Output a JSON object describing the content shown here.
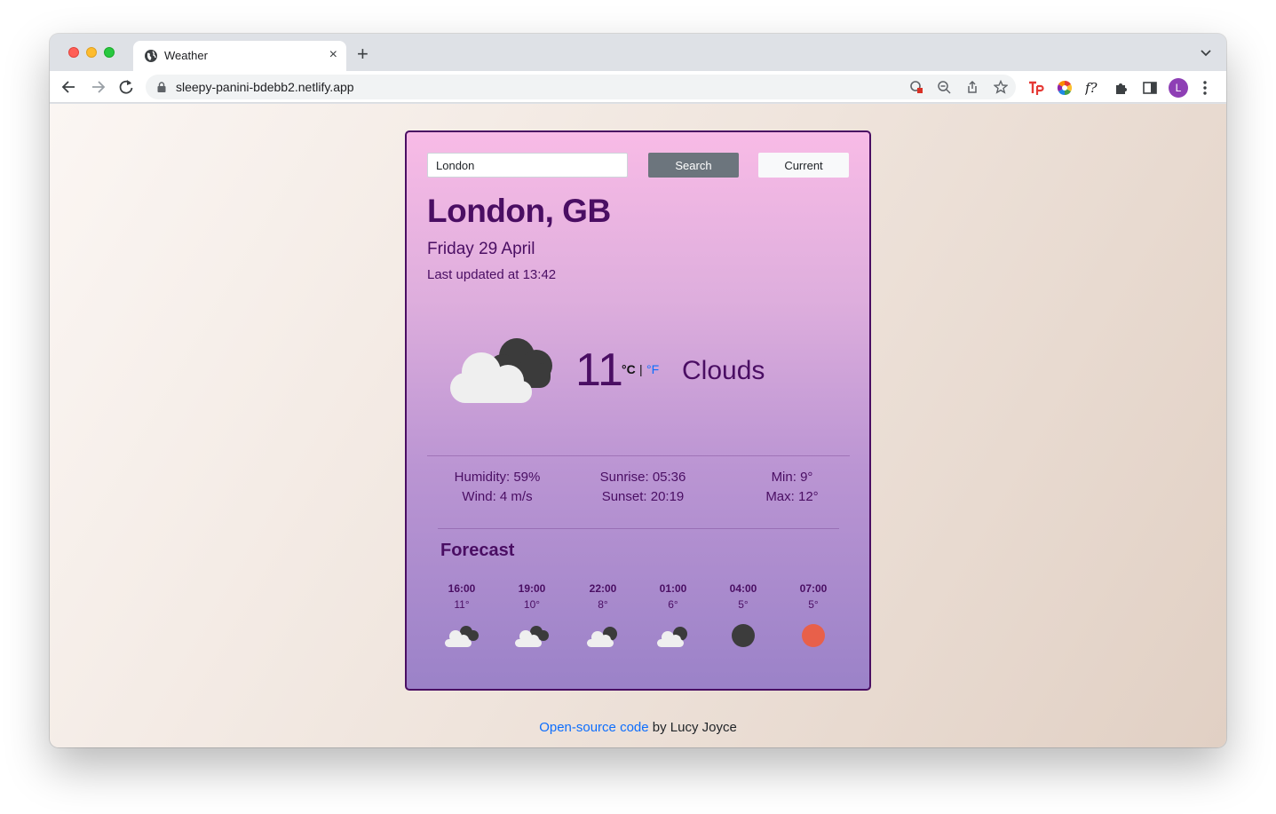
{
  "browser": {
    "tab_title": "Weather",
    "tab_close": "×",
    "new_tab": "+",
    "url": "sleepy-panini-bdebb2.netlify.app",
    "profile_initial": "L"
  },
  "search": {
    "value": "London",
    "search_label": "Search",
    "current_label": "Current"
  },
  "location": {
    "city": "London, GB",
    "date": "Friday 29 April",
    "last_updated": "Last updated at 13:42"
  },
  "current": {
    "temperature": "11",
    "unit_c": "°C",
    "unit_separator": "|",
    "unit_f": "°F",
    "description": "Clouds",
    "icon": "cloud-broken-icon"
  },
  "stats": {
    "humidity": "Humidity: 59%",
    "wind": "Wind: 4 m/s",
    "sunrise": "Sunrise: 05:36",
    "sunset": "Sunset: 20:19",
    "min": "Min: 9°",
    "max": "Max: 12°"
  },
  "forecast": {
    "title": "Forecast",
    "items": [
      {
        "time": "16:00",
        "temp": "11°",
        "icon": "cloud-broken-icon"
      },
      {
        "time": "19:00",
        "temp": "10°",
        "icon": "cloud-broken-icon"
      },
      {
        "time": "22:00",
        "temp": "8°",
        "icon": "cloud-night-icon"
      },
      {
        "time": "01:00",
        "temp": "6°",
        "icon": "cloud-night-icon"
      },
      {
        "time": "04:00",
        "temp": "5°",
        "icon": "moon-clear-icon"
      },
      {
        "time": "07:00",
        "temp": "5°",
        "icon": "sun-clear-icon"
      }
    ]
  },
  "footer": {
    "link_text": "Open-source code",
    "suffix": " by Lucy Joyce"
  },
  "colors": {
    "card_text": "#4a0e63",
    "card_border": "#4a0e63",
    "link": "#0d6efd",
    "search_button": "#6c757d",
    "sun": "#e8604a",
    "moon": "#3c3c3c"
  }
}
